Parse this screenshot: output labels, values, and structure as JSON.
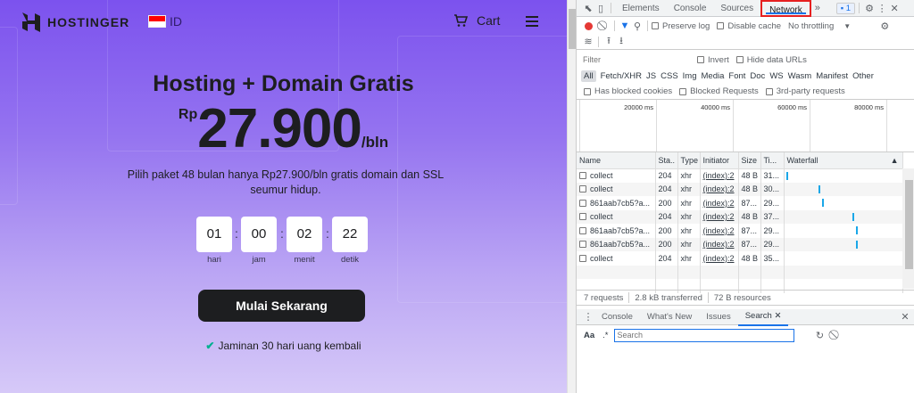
{
  "page": {
    "brand": "HOSTINGER",
    "lang": "ID",
    "cart": "Cart",
    "title": "Hosting + Domain Gratis",
    "price": {
      "currency": "Rp",
      "amount": "27.900",
      "per": "/bln"
    },
    "subtitle": "Pilih paket 48 bulan hanya Rp27.900/bln gratis domain dan SSL seumur hidup.",
    "countdown": [
      {
        "value": "01",
        "label": "hari"
      },
      {
        "value": "00",
        "label": "jam"
      },
      {
        "value": "02",
        "label": "menit"
      },
      {
        "value": "22",
        "label": "detik"
      }
    ],
    "cta": "Mulai Sekarang",
    "guarantee": "Jaminan 30 hari uang kembali"
  },
  "devtools": {
    "tabs": [
      "Elements",
      "Console",
      "Sources",
      "Network"
    ],
    "issues_count": "1",
    "preserve_log": "Preserve log",
    "disable_cache": "Disable cache",
    "throttling": "No throttling",
    "filter_placeholder": "Filter",
    "invert": "Invert",
    "hide_data_urls": "Hide data URLs",
    "types": [
      "All",
      "Fetch/XHR",
      "JS",
      "CSS",
      "Img",
      "Media",
      "Font",
      "Doc",
      "WS",
      "Wasm",
      "Manifest",
      "Other"
    ],
    "has_blocked_cookies": "Has blocked cookies",
    "blocked_requests": "Blocked Requests",
    "third_party": "3rd-party requests",
    "overview_ticks": [
      "20000 ms",
      "40000 ms",
      "60000 ms",
      "80000 ms"
    ],
    "columns": [
      "Name",
      "Sta..",
      "Type",
      "Initiator",
      "Size",
      "Ti...",
      "Waterfall"
    ],
    "rows": [
      [
        "collect",
        "204",
        "xhr",
        "(index):2",
        "48 B",
        "31..."
      ],
      [
        "collect",
        "204",
        "xhr",
        "(index):2",
        "48 B",
        "30..."
      ],
      [
        "861aab7cb5?a...",
        "200",
        "xhr",
        "(index):2",
        "87...",
        "29..."
      ],
      [
        "collect",
        "204",
        "xhr",
        "(index):2",
        "48 B",
        "37..."
      ],
      [
        "861aab7cb5?a...",
        "200",
        "xhr",
        "(index):2",
        "87...",
        "29..."
      ],
      [
        "861aab7cb5?a...",
        "200",
        "xhr",
        "(index):2",
        "87...",
        "29..."
      ],
      [
        "collect",
        "204",
        "xhr",
        "(index):2",
        "48 B",
        "35..."
      ]
    ],
    "summary": [
      "7 requests",
      "2.8 kB transferred",
      "72 B resources"
    ],
    "drawer_tabs": [
      "Console",
      "What's New",
      "Issues",
      "Search"
    ],
    "search_placeholder": "Search",
    "aa": "Aa",
    "regex": ".*"
  }
}
